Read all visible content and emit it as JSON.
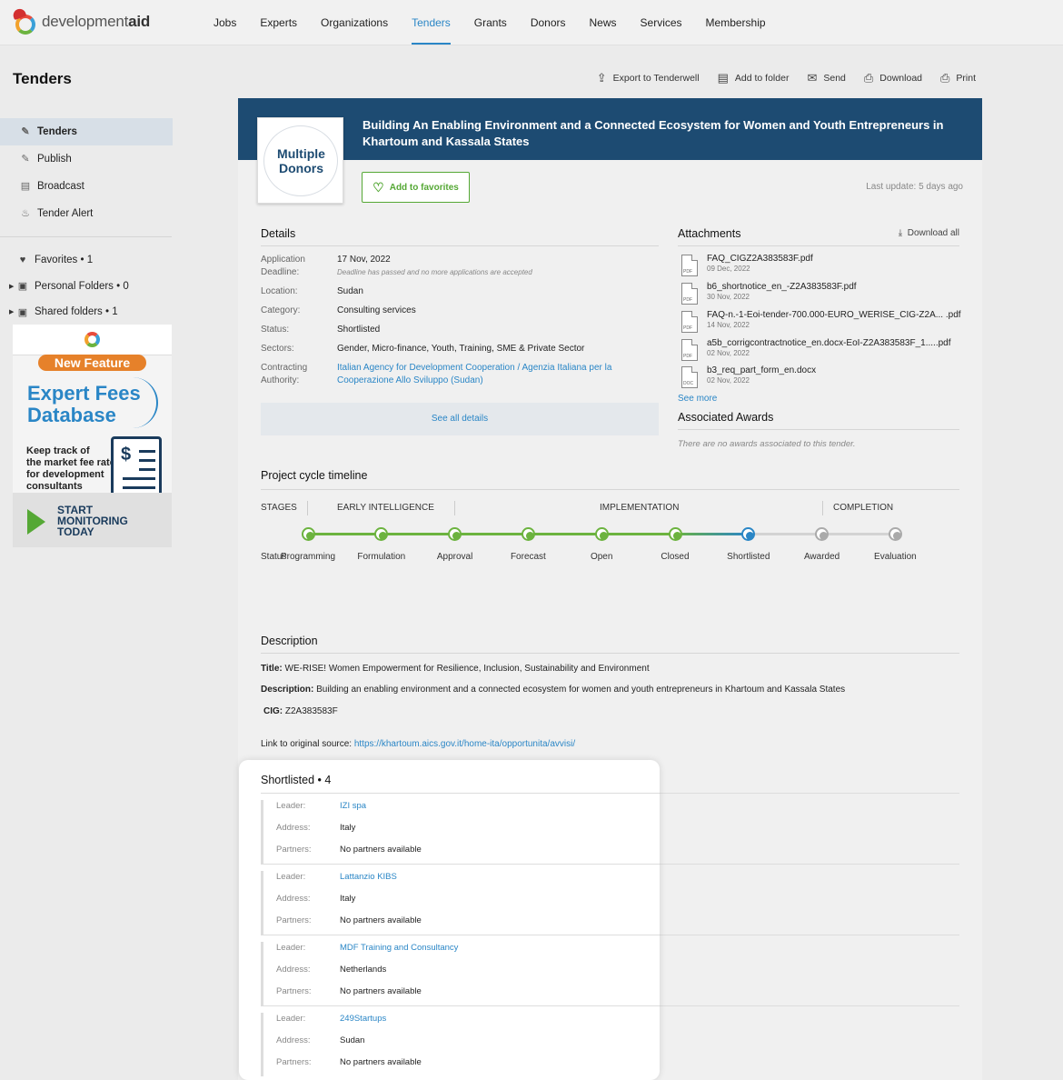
{
  "brand": {
    "name_light": "development",
    "name_bold": "aid"
  },
  "nav": [
    "Jobs",
    "Experts",
    "Organizations",
    "Tenders",
    "Grants",
    "Donors",
    "News",
    "Services",
    "Membership"
  ],
  "nav_active": "Tenders",
  "page_title": "Tenders",
  "sidebar": {
    "items": [
      {
        "label": "Tenders",
        "icon": "edit-icon",
        "active": true
      },
      {
        "label": "Publish",
        "icon": "pencil-icon"
      },
      {
        "label": "Broadcast",
        "icon": "broadcast-icon"
      },
      {
        "label": "Tender Alert",
        "icon": "bell-icon"
      }
    ],
    "folders": [
      {
        "label": "Favorites • 1",
        "icon": "heart-icon"
      },
      {
        "label": "Personal Folders • 0",
        "icon": "person-folder-icon"
      },
      {
        "label": "Shared folders • 1",
        "icon": "shared-folder-icon"
      }
    ]
  },
  "promo": {
    "badge": "New Feature",
    "title_line1": "Expert Fees",
    "title_line2": "Database",
    "keep_line1": "Keep track of",
    "keep_line2": "the market fee rate",
    "keep_line3": "for development",
    "keep_line4": "consultants",
    "cta_line1": "START",
    "cta_line2": "MONITORING",
    "cta_line3": "TODAY"
  },
  "toolbar": [
    {
      "label": "Export to Tenderwell",
      "icon": "export-icon"
    },
    {
      "label": "Add to folder",
      "icon": "folder-icon"
    },
    {
      "label": "Send",
      "icon": "mail-icon"
    },
    {
      "label": "Download",
      "icon": "download-icon"
    },
    {
      "label": "Print",
      "icon": "print-icon"
    }
  ],
  "tender": {
    "title": "Building An Enabling Environment and a Connected Ecosystem for Women and Youth Entrepreneurs in Khartoum and Kassala States",
    "donor_line1": "Multiple",
    "donor_line2": "Donors",
    "favorites_button": "Add to favorites",
    "last_update": "Last update: 5 days ago"
  },
  "details": {
    "heading": "Details",
    "rows": [
      {
        "label": "Application Deadline:",
        "value": "17 Nov, 2022",
        "note": "Deadline has passed and no more applications are accepted"
      },
      {
        "label": "Location:",
        "value": "Sudan"
      },
      {
        "label": "Category:",
        "value": "Consulting services"
      },
      {
        "label": "Status:",
        "value": "Shortlisted"
      },
      {
        "label": "Sectors:",
        "value": "Gender, Micro-finance, Youth, Training, SME & Private Sector"
      },
      {
        "label": "Contracting Authority:",
        "value": "Italian Agency for Development Cooperation / Agenzia Italiana per la Cooperazione Allo Sviluppo (Sudan)",
        "link": true
      }
    ],
    "see_all": "See all details"
  },
  "attachments": {
    "heading": "Attachments",
    "download_all": "Download all",
    "files": [
      {
        "name": "FAQ_CIGZ2A383583F.pdf",
        "date": "09 Dec, 2022",
        "type": "PDF"
      },
      {
        "name": "b6_shortnotice_en_-Z2A383583F.pdf",
        "date": "30 Nov, 2022",
        "type": "PDF"
      },
      {
        "name": "FAQ-n.-1-Eoi-tender-700.000-EURO_WERISE_CIG-Z2A... .pdf",
        "date": "14 Nov, 2022",
        "type": "PDF"
      },
      {
        "name": "a5b_corrigcontractnotice_en.docx-EoI-Z2A383583F_1.....pdf",
        "date": "02 Nov, 2022",
        "type": "PDF"
      },
      {
        "name": "b3_req_part_form_en.docx",
        "date": "02 Nov, 2022",
        "type": "DOC"
      }
    ],
    "see_more": "See more"
  },
  "awards": {
    "heading": "Associated Awards",
    "empty": "There are no awards associated to this tender."
  },
  "timeline": {
    "heading": "Project cycle timeline",
    "stages_label": "STAGES",
    "stage_groups": [
      "EARLY INTELLIGENCE",
      "IMPLEMENTATION",
      "COMPLETION"
    ],
    "status_label": "Status",
    "steps": [
      {
        "label": "Programming",
        "state": "done"
      },
      {
        "label": "Formulation",
        "state": "done"
      },
      {
        "label": "Approval",
        "state": "done"
      },
      {
        "label": "Forecast",
        "state": "done"
      },
      {
        "label": "Open",
        "state": "done"
      },
      {
        "label": "Closed",
        "state": "done"
      },
      {
        "label": "Shortlisted",
        "state": "current"
      },
      {
        "label": "Awarded",
        "state": "pending"
      },
      {
        "label": "Evaluation",
        "state": "pending"
      }
    ],
    "colors": {
      "done": "#6cb33f",
      "current": "#2a86c6",
      "pending": "#aaaaaa"
    }
  },
  "description": {
    "heading": "Description",
    "title_label": "Title:",
    "title_value": "WE-RISE! Women Empowerment for Resilience, Inclusion, Sustainability and Environment",
    "desc_label": "Description:",
    "desc_value": "Building an enabling environment and a connected ecosystem for women and youth entrepreneurs in Khartoum and Kassala States",
    "cig_label": "CIG:",
    "cig_value": "Z2A383583F",
    "source_label": "Link to original source:",
    "source_url": "https://khartoum.aics.gov.it/home-ita/opportunita/avvisi/"
  },
  "shortlisted": {
    "heading": "Shortlisted • 4",
    "leader_label": "Leader:",
    "address_label": "Address:",
    "partners_label": "Partners:",
    "entries": [
      {
        "leader": "IZI spa",
        "address": "Italy",
        "partners": "No partners available"
      },
      {
        "leader": "Lattanzio KIBS",
        "address": "Italy",
        "partners": "No partners available"
      },
      {
        "leader": "MDF Training and Consultancy",
        "address": "Netherlands",
        "partners": "No partners available"
      },
      {
        "leader": "249Startups",
        "address": "Sudan",
        "partners": "No partners available"
      }
    ]
  }
}
